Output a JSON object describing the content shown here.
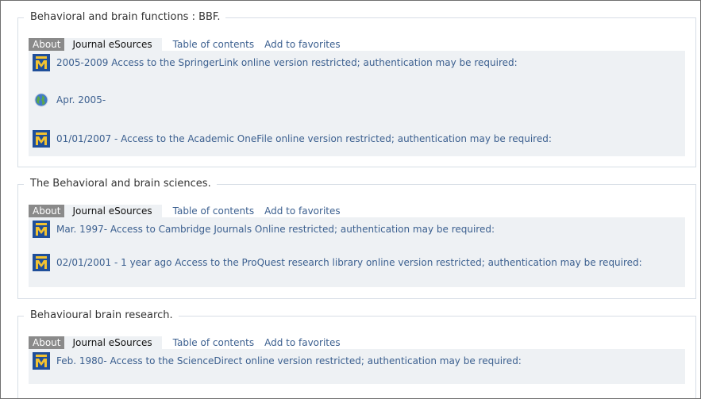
{
  "tabs": {
    "about": "About",
    "esources": "Journal eSources",
    "toc": "Table of contents",
    "favorites": "Add to favorites"
  },
  "records": [
    {
      "title": "Behavioral and brain functions : BBF.",
      "entries": [
        {
          "icon": "umich-m-icon",
          "text": "2005-2009 Access to the SpringerLink online version restricted; authentication may be required:"
        },
        {
          "icon": "globe-icon",
          "text": "Apr. 2005-"
        },
        {
          "icon": "umich-m-icon",
          "text": "01/01/2007 - Access to the Academic OneFile online version restricted; authentication may be required:"
        }
      ]
    },
    {
      "title": "The Behavioral and brain sciences.",
      "entries": [
        {
          "icon": "umich-m-icon",
          "text": "Mar. 1997- Access to Cambridge Journals Online restricted; authentication may be required:"
        },
        {
          "icon": "umich-m-icon",
          "text": "02/01/2001 - 1 year ago Access to the ProQuest research library online version restricted; authentication may be required:"
        }
      ]
    },
    {
      "title": "Behavioural brain research.",
      "entries": [
        {
          "icon": "umich-m-icon",
          "text": "Feb. 1980- Access to the ScienceDirect online version restricted; authentication may be required:"
        }
      ]
    }
  ],
  "colors": {
    "link": "#3b5f8f",
    "panel": "#eef1f4",
    "about_tab": "#8a8a8a",
    "border": "#d7dee6",
    "m_icon_blue": "#1f4f9a",
    "m_icon_gold": "#f2c230"
  }
}
